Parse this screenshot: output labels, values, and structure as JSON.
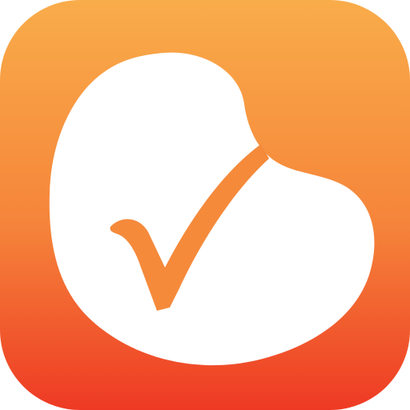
{
  "app_icon": {
    "icon_name": "bean-checkmark-icon",
    "colors": {
      "gradient_top": "#F9AC4A",
      "gradient_mid": "#F5843A",
      "gradient_bottom": "#EE3A24",
      "bean_fill": "#FFFFFF",
      "check_color": "#F58A3B"
    }
  }
}
